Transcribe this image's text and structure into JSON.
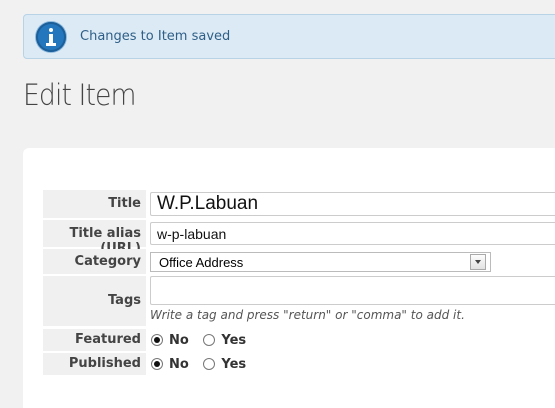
{
  "notice": {
    "message": "Changes to Item saved",
    "icon": "info-icon",
    "accent": "#2477bd"
  },
  "page": {
    "title": "Edit Item"
  },
  "form": {
    "title": {
      "label": "Title",
      "value": "W.P.Labuan"
    },
    "alias": {
      "label": "Title alias (URL)",
      "value": "w-p-labuan"
    },
    "category": {
      "label": "Category",
      "selected": "Office Address"
    },
    "tags": {
      "label": "Tags",
      "value": "",
      "hint": "Write a tag and press \"return\" or \"comma\" to add it."
    },
    "featured": {
      "label": "Featured",
      "options": [
        "No",
        "Yes"
      ],
      "selected": "No"
    },
    "published": {
      "label": "Published",
      "options": [
        "No",
        "Yes"
      ],
      "selected": "No"
    }
  }
}
